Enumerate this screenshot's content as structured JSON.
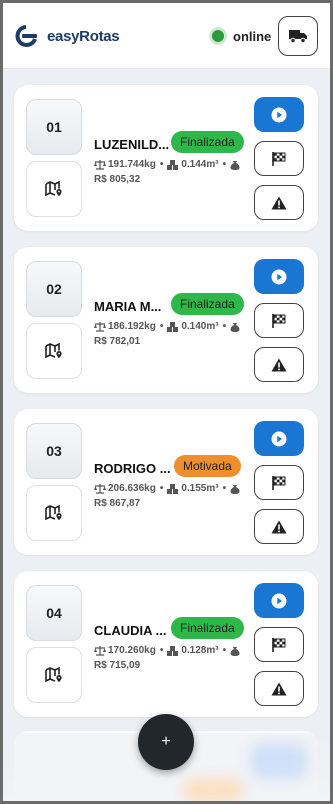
{
  "header": {
    "brand": "easyRotas",
    "status_label": "online",
    "status_color": "#2a9a3a",
    "truck_icon": "truck-icon"
  },
  "colors": {
    "primary": "#1976d2",
    "finalizada": "#2fb84a",
    "motivada": "#ef8f2c"
  },
  "cards": [
    {
      "number": "01",
      "name": "LUZENILD...",
      "status": "Finalizada",
      "weight": "191.744kg",
      "volume": "0.144m³",
      "price": "R$ 805,32"
    },
    {
      "number": "02",
      "name": "MARIA M...",
      "status": "Finalizada",
      "weight": "186.192kg",
      "volume": "0.140m³",
      "price": "R$ 782,01"
    },
    {
      "number": "03",
      "name": "RODRIGO ...",
      "status": "Motivada",
      "weight": "206.636kg",
      "volume": "0.155m³",
      "price": "R$ 867,87"
    },
    {
      "number": "04",
      "name": "CLAUDIA ...",
      "status": "Finalizada",
      "weight": "170.260kg",
      "volume": "0.128m³",
      "price": "R$ 715,09"
    }
  ],
  "fab": {
    "label": "+"
  }
}
